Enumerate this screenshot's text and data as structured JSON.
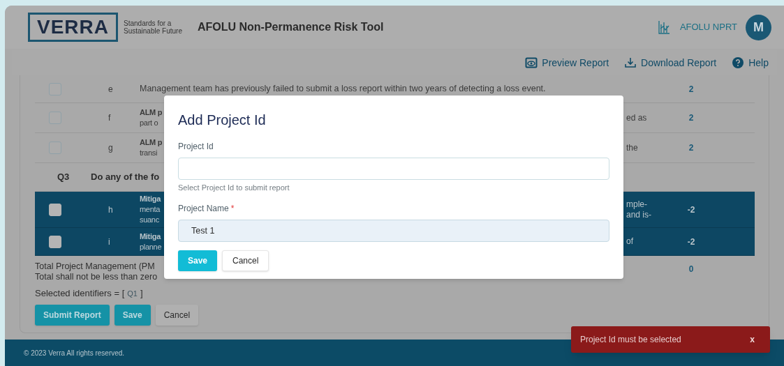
{
  "header": {
    "logo": "VERRA",
    "tagline": [
      "Standards for a",
      "Sustainable Future"
    ],
    "title": "AFOLU Non-Permanence Risk Tool",
    "app_name": "AFOLU NPRT",
    "avatar": "M"
  },
  "toolbar": [
    {
      "kind": "preview",
      "label": "Preview Report"
    },
    {
      "kind": "download",
      "label": "Download Report"
    },
    {
      "kind": "help",
      "label": "Help"
    }
  ],
  "rows": [
    {
      "kind": "item",
      "checked": false,
      "selected": false,
      "letter": "e",
      "text": "Management team has previously failed to submit a loss report within two years of detecting a loss event.",
      "score": "2"
    },
    {
      "kind": "item",
      "checked": false,
      "selected": false,
      "letter": "f",
      "left": [
        {
          "text": "ALM p",
          "bold": true
        },
        {
          "text": "part o",
          "bold": false
        }
      ],
      "right": [
        "ed as"
      ],
      "score": "2"
    },
    {
      "kind": "item",
      "checked": false,
      "selected": false,
      "letter": "g",
      "left": [
        {
          "text": "ALM p",
          "bold": true
        },
        {
          "text": "transi",
          "bold": false
        }
      ],
      "right": [
        "the"
      ],
      "score": "2"
    },
    {
      "kind": "question",
      "id": "Q3",
      "text": "Do any of the fo"
    },
    {
      "kind": "item",
      "checked": false,
      "selected": true,
      "letter": "h",
      "left": [
        {
          "text": "Mitiga",
          "bold": true
        },
        {
          "text": "menta",
          "bold": false
        },
        {
          "text": "suanc",
          "bold": false
        }
      ],
      "right": [
        "mple-",
        "and is-"
      ],
      "score": "-2"
    },
    {
      "kind": "item",
      "checked": false,
      "selected": true,
      "letter": "i",
      "left": [
        {
          "text": "Mitiga",
          "bold": true
        },
        {
          "text": "planne",
          "bold": false
        }
      ],
      "right": [
        "of"
      ],
      "score": "-2"
    }
  ],
  "summary": {
    "lines": [
      "Total Project Management (PM",
      "Total shall not be less than zero"
    ],
    "total": "0",
    "identifiers_label": "Selected identifiers = [",
    "identifiers": [
      "Q1"
    ],
    "identifiers_close": "]"
  },
  "actions": [
    {
      "kind": "primary",
      "label": "Submit Report"
    },
    {
      "kind": "primary",
      "label": "Save"
    },
    {
      "kind": "secondary",
      "label": "Cancel"
    }
  ],
  "footer": {
    "copyright": "© 2023 Verra All rights reserved."
  },
  "dialog": {
    "title": "Add Project Id",
    "fields": [
      {
        "label": "Project Id",
        "hint": "Select Project Id to submit report"
      },
      {
        "label": "Project Name",
        "required_mark": "*",
        "value": "Test 1"
      }
    ],
    "buttons": [
      {
        "kind": "primary",
        "label": "Save"
      },
      {
        "kind": "secondary",
        "label": "Cancel"
      }
    ]
  },
  "toast": {
    "message": "Project Id must be selected",
    "close": "x"
  }
}
